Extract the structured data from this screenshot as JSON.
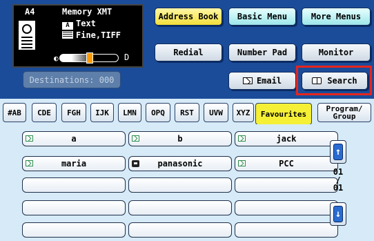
{
  "status": {
    "paper_size": "A4",
    "memory_label": "Memory XMT",
    "text_mode_icon": "A",
    "text_mode": "Text",
    "resolution": "Fine,TIFF",
    "contrast_dark_symbol": "◐",
    "contrast_light_symbol": "D"
  },
  "destinations": "Destinations: 000",
  "top_buttons": {
    "address_book": "Address Book",
    "basic_menu": "Basic Menu",
    "more_menus": "More Menus",
    "redial": "Redial",
    "number_pad": "Number Pad",
    "monitor": "Monitor",
    "email": "Email",
    "search": "Search"
  },
  "tabs": [
    {
      "label": "#AB"
    },
    {
      "label": "CDE"
    },
    {
      "label": "FGH"
    },
    {
      "label": "IJK"
    },
    {
      "label": "LMN"
    },
    {
      "label": "OPQ"
    },
    {
      "label": "RST"
    },
    {
      "label": "UVW"
    },
    {
      "label": "XYZ"
    },
    {
      "label": "Favourites"
    },
    {
      "label": "Program/"
    },
    {
      "label": "Group"
    }
  ],
  "entries": [
    {
      "name": "a",
      "type": "email-icon"
    },
    {
      "name": "b",
      "type": "email-icon"
    },
    {
      "name": "jack",
      "type": "email-icon"
    },
    {
      "name": "maria",
      "type": "email-icon"
    },
    {
      "name": "panasonic",
      "type": "fax-icon"
    },
    {
      "name": "PCC",
      "type": "email-icon"
    }
  ],
  "page_indicator": {
    "current": "01",
    "separator": "/",
    "total": "01"
  },
  "colors": {
    "background": "#1b4c99",
    "active_tab": "#f5ef36",
    "highlight": "#e8251d"
  }
}
